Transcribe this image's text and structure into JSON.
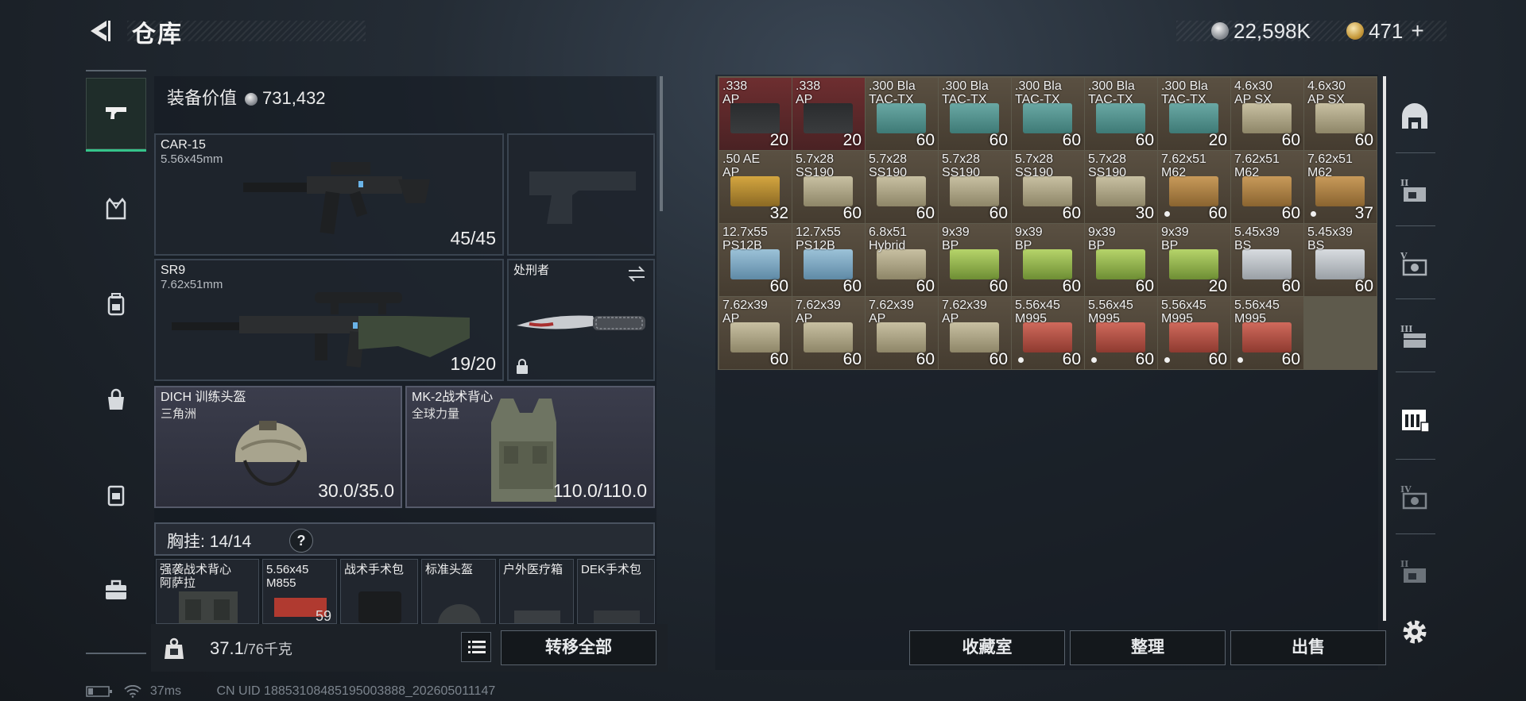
{
  "header": {
    "title": "仓库",
    "currency_silver": "22,598K",
    "currency_gold": "471",
    "gold_plus": "+"
  },
  "left_nav": [
    "pistol-icon",
    "armor-vest-icon",
    "backpack-icon",
    "bag-icon",
    "case-icon",
    "toolbox-icon"
  ],
  "equipment": {
    "value_label": "装备价值",
    "value": "731,432",
    "primary": {
      "name": "CAR-15",
      "caliber": "5.56x45mm",
      "ammo": "45/45"
    },
    "secondary": {
      "name": "SR9",
      "caliber": "7.62x51mm",
      "ammo": "19/20"
    },
    "melee": {
      "name": "处刑者"
    },
    "helmet": {
      "name": "DICH 训练头盔",
      "sub": "三角洲",
      "durability": "30.0/35.0"
    },
    "armor": {
      "name": "MK-2战术背心",
      "sub": "全球力量",
      "durability": "110.0/110.0"
    }
  },
  "chest_rig": {
    "label": "胸挂:",
    "capacity": "14/14",
    "help": "?",
    "items": [
      {
        "name": "强袭战术背心\n阿萨拉",
        "count": ""
      },
      {
        "name": "5.56x45\nM855",
        "count": "59"
      },
      {
        "name": "战术手术包",
        "count": ""
      },
      {
        "name": "标准头盔",
        "count": ""
      },
      {
        "name": "户外医疗箱",
        "count": ""
      },
      {
        "name": "DEK手术包",
        "count": ""
      }
    ]
  },
  "weight": {
    "current": "37.1",
    "max": "/76千克"
  },
  "buttons": {
    "transfer_all": "转移全部",
    "collection": "收藏室",
    "organize": "整理",
    "sell": "出售"
  },
  "status": {
    "ping": "37ms",
    "uid": "CN UID 18853108485195003888_202605011147"
  },
  "storage": [
    {
      "label": ".338\nAP",
      "count": "20",
      "color": "red",
      "dot": false
    },
    {
      "label": ".338\nAP",
      "count": "20",
      "color": "red",
      "dot": false
    },
    {
      "label": ".300 Bla\nTAC-TX",
      "count": "60",
      "color": "teal",
      "dot": false
    },
    {
      "label": ".300 Bla\nTAC-TX",
      "count": "60",
      "color": "teal",
      "dot": false
    },
    {
      "label": ".300 Bla\nTAC-TX",
      "count": "60",
      "color": "teal",
      "dot": false
    },
    {
      "label": ".300 Bla\nTAC-TX",
      "count": "60",
      "color": "teal",
      "dot": false
    },
    {
      "label": ".300 Bla\nTAC-TX",
      "count": "20",
      "color": "teal",
      "dot": false
    },
    {
      "label": "4.6x30\nAP SX",
      "count": "60",
      "color": "tan",
      "dot": false
    },
    {
      "label": "4.6x30\nAP SX",
      "count": "60",
      "color": "tan",
      "dot": false
    },
    {
      "label": ".50 AE\nAP",
      "count": "32",
      "color": "gold",
      "dot": false
    },
    {
      "label": "5.7x28\nSS190",
      "count": "60",
      "color": "tan",
      "dot": false
    },
    {
      "label": "5.7x28\nSS190",
      "count": "60",
      "color": "tan",
      "dot": false
    },
    {
      "label": "5.7x28\nSS190",
      "count": "60",
      "color": "tan",
      "dot": false
    },
    {
      "label": "5.7x28\nSS190",
      "count": "60",
      "color": "tan",
      "dot": false
    },
    {
      "label": "5.7x28\nSS190",
      "count": "30",
      "color": "tan",
      "dot": false
    },
    {
      "label": "7.62x51\nM62",
      "count": "60",
      "color": "wood",
      "dot": true
    },
    {
      "label": "7.62x51\nM62",
      "count": "60",
      "color": "wood",
      "dot": false
    },
    {
      "label": "7.62x51\nM62",
      "count": "37",
      "color": "wood",
      "dot": true
    },
    {
      "label": "12.7x55\nPS12B",
      "count": "60",
      "color": "blue",
      "dot": false
    },
    {
      "label": "12.7x55\nPS12B",
      "count": "60",
      "color": "blue",
      "dot": false
    },
    {
      "label": "6.8x51\nHybrid",
      "count": "60",
      "color": "tan",
      "dot": false
    },
    {
      "label": "9x39\nBP",
      "count": "60",
      "color": "green",
      "dot": false
    },
    {
      "label": "9x39\nBP",
      "count": "60",
      "color": "green",
      "dot": false
    },
    {
      "label": "9x39\nBP",
      "count": "60",
      "color": "green",
      "dot": false
    },
    {
      "label": "9x39\nBP",
      "count": "20",
      "color": "green",
      "dot": false
    },
    {
      "label": "5.45x39\nBS",
      "count": "60",
      "color": "silver",
      "dot": false
    },
    {
      "label": "5.45x39\nBS",
      "count": "60",
      "color": "silver",
      "dot": false
    },
    {
      "label": "7.62x39\nAP",
      "count": "60",
      "color": "tan",
      "dot": false
    },
    {
      "label": "7.62x39\nAP",
      "count": "60",
      "color": "tan",
      "dot": false
    },
    {
      "label": "7.62x39\nAP",
      "count": "60",
      "color": "tan",
      "dot": false
    },
    {
      "label": "7.62x39\nAP",
      "count": "60",
      "color": "tan",
      "dot": false
    },
    {
      "label": "5.56x45\nM995",
      "count": "60",
      "color": "redbox",
      "dot": true
    },
    {
      "label": "5.56x45\nM995",
      "count": "60",
      "color": "redbox",
      "dot": true
    },
    {
      "label": "5.56x45\nM995",
      "count": "60",
      "color": "redbox",
      "dot": true
    },
    {
      "label": "5.56x45\nM995",
      "count": "60",
      "color": "redbox",
      "dot": true
    }
  ],
  "right_nav": [
    "helmet-tab-icon",
    "level-ii-case-icon",
    "level-v-case-icon",
    "level-iii-case-icon",
    "safe-case-icon",
    "level-iv-case-icon",
    "level-ii-case-icon-2",
    "settings-icon"
  ],
  "colors": {
    "accent_green": "#35c48a",
    "panel": "#20262e",
    "cell_tan": "#4e4538",
    "cell_red": "#5a2628"
  }
}
